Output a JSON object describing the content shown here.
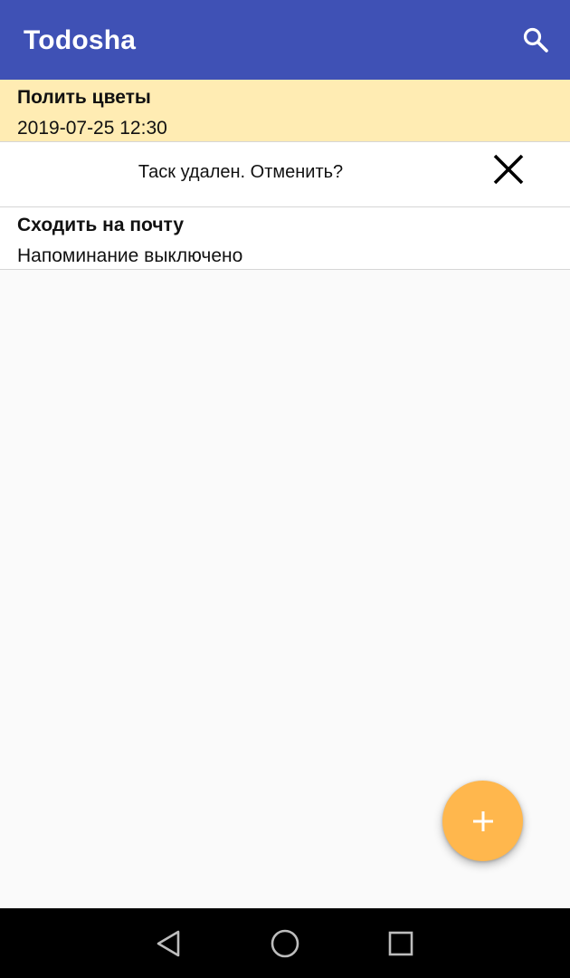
{
  "app": {
    "title": "Todosha",
    "header_color": "#3f51b5",
    "search_icon": "search-icon"
  },
  "tasks": [
    {
      "name": "Полить цветы",
      "subtitle": "2019-07-25 12:30",
      "highlighted": true,
      "highlight_color": "#ffecb3"
    },
    {
      "name": "Сходить на почту",
      "subtitle": "Напоминание выключено",
      "highlighted": false
    }
  ],
  "undo_bar": {
    "message": "Таск удален. Отменить?",
    "close_icon": "close-icon"
  },
  "fab": {
    "icon": "plus-icon",
    "color": "#ffb74d"
  },
  "navigation": {
    "back_icon": "back-triangle-icon",
    "home_icon": "home-circle-icon",
    "recents_icon": "recents-square-icon"
  }
}
